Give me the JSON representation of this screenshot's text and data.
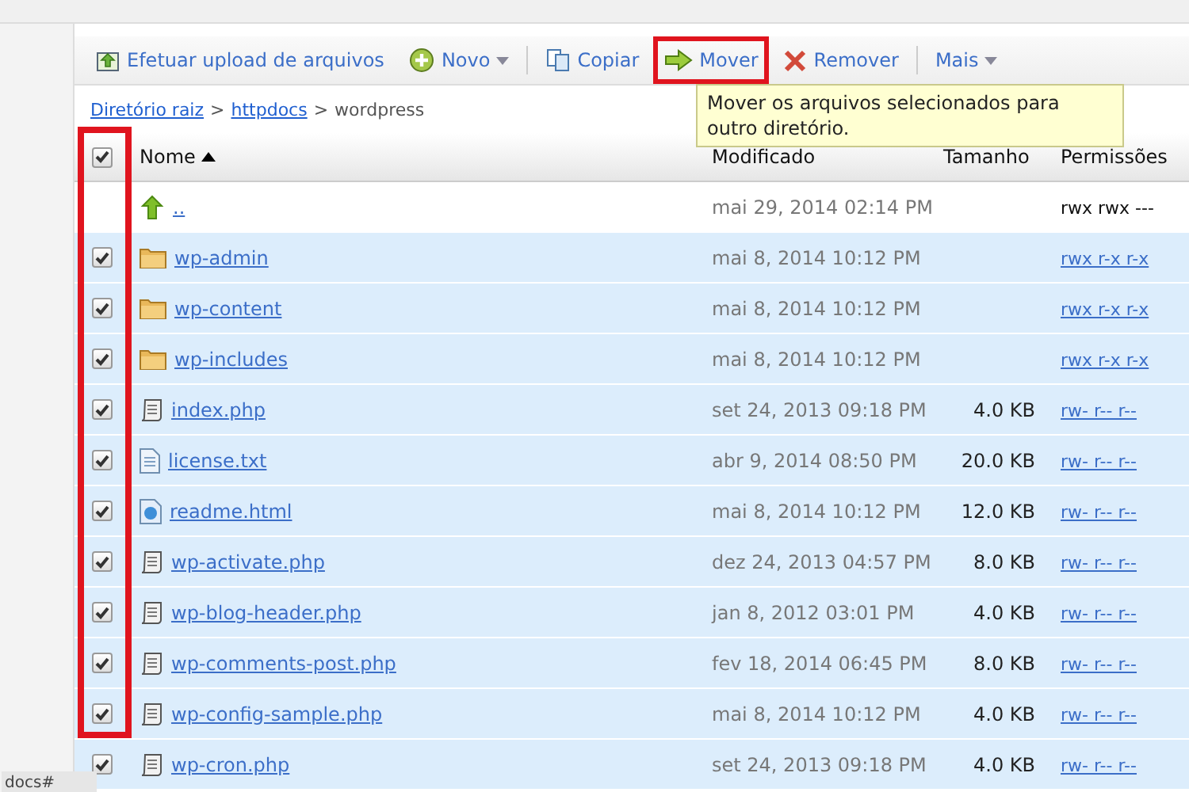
{
  "toolbar": {
    "buttons": [
      {
        "label": "Efetuar upload de arquivos",
        "kind": "upload",
        "dropdown": false,
        "highlighted": false
      },
      {
        "label": "Novo",
        "kind": "new",
        "dropdown": true,
        "highlighted": false
      },
      {
        "label": "Copiar",
        "kind": "copy",
        "dropdown": false,
        "highlighted": false
      },
      {
        "label": "Mover",
        "kind": "move",
        "dropdown": false,
        "highlighted": true
      },
      {
        "label": "Remover",
        "kind": "remove",
        "dropdown": false,
        "highlighted": false
      },
      {
        "label": "Mais",
        "kind": "more",
        "dropdown": true,
        "highlighted": false
      }
    ]
  },
  "tooltip": "Mover os arquivos selecionados para outro diretório.",
  "breadcrumb": {
    "links": [
      "Diretório raiz",
      "httpdocs"
    ],
    "current": "wordpress",
    "separator": ">"
  },
  "table": {
    "select_all_checked": true,
    "checkbox_column_highlighted": true,
    "columns": [
      {
        "label": "Nome",
        "sorted": true
      },
      {
        "label": "Modificado",
        "sorted": false
      },
      {
        "label": "Tamanho",
        "sorted": false
      },
      {
        "label": "Permissões",
        "sorted": false
      }
    ],
    "rows": [
      {
        "kind": "up",
        "name": "..",
        "modified": "mai 29, 2014 02:14 PM",
        "size": "",
        "permissions": "rwx rwx ---"
      },
      {
        "kind": "folder",
        "checked": true,
        "name": "wp-admin",
        "modified": "mai 8, 2014 10:12 PM",
        "size": "",
        "permissions": "rwx r-x r-x"
      },
      {
        "kind": "folder",
        "checked": true,
        "name": "wp-content",
        "modified": "mai 8, 2014 10:12 PM",
        "size": "",
        "permissions": "rwx r-x r-x"
      },
      {
        "kind": "folder",
        "checked": true,
        "name": "wp-includes",
        "modified": "mai 8, 2014 10:12 PM",
        "size": "",
        "permissions": "rwx r-x r-x"
      },
      {
        "kind": "script",
        "checked": true,
        "name": "index.php",
        "modified": "set 24, 2013 09:18 PM",
        "size": "4.0 KB",
        "permissions": "rw- r-- r--"
      },
      {
        "kind": "text",
        "checked": true,
        "name": "license.txt",
        "modified": "abr 9, 2014 08:50 PM",
        "size": "20.0 KB",
        "permissions": "rw- r-- r--"
      },
      {
        "kind": "html",
        "checked": true,
        "name": "readme.html",
        "modified": "mai 8, 2014 10:12 PM",
        "size": "12.0 KB",
        "permissions": "rw- r-- r--"
      },
      {
        "kind": "script",
        "checked": true,
        "name": "wp-activate.php",
        "modified": "dez 24, 2013 04:57 PM",
        "size": "8.0 KB",
        "permissions": "rw- r-- r--"
      },
      {
        "kind": "script",
        "checked": true,
        "name": "wp-blog-header.php",
        "modified": "jan 8, 2012 03:01 PM",
        "size": "4.0 KB",
        "permissions": "rw- r-- r--"
      },
      {
        "kind": "script",
        "checked": true,
        "name": "wp-comments-post.php",
        "modified": "fev 18, 2014 06:45 PM",
        "size": "8.0 KB",
        "permissions": "rw- r-- r--"
      },
      {
        "kind": "script",
        "checked": true,
        "name": "wp-config-sample.php",
        "modified": "mai 8, 2014 10:12 PM",
        "size": "4.0 KB",
        "permissions": "rw- r-- r--"
      },
      {
        "kind": "script",
        "checked": true,
        "name": "wp-cron.php",
        "modified": "set 24, 2013 09:18 PM",
        "size": "4.0 KB",
        "permissions": "rw- r-- r--"
      }
    ]
  },
  "footer_fragment": "docs#"
}
